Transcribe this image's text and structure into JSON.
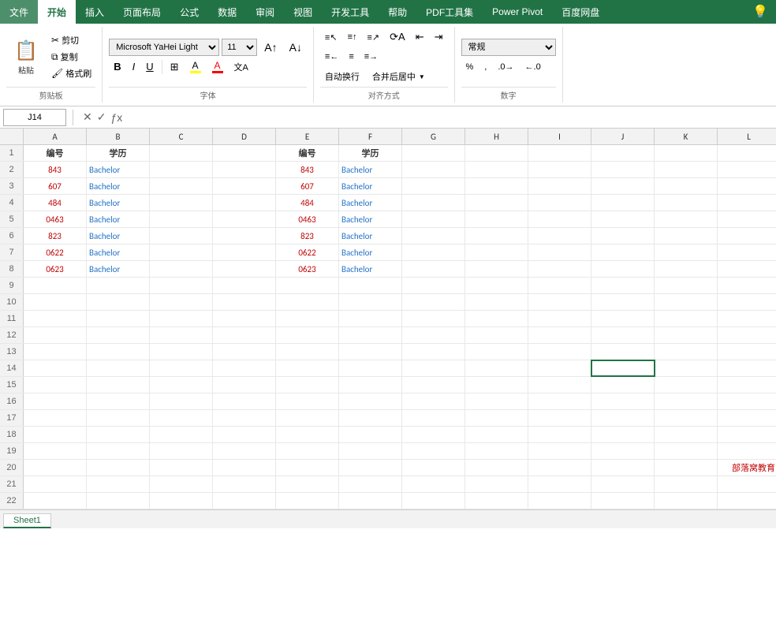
{
  "ribbon": {
    "tabs": [
      "文件",
      "开始",
      "插入",
      "页面布局",
      "公式",
      "数据",
      "审阅",
      "视图",
      "开发工具",
      "帮助",
      "PDF工具集",
      "Power Pivot",
      "百度网盘"
    ],
    "active_tab": "开始",
    "clipboard": {
      "paste": "粘贴",
      "cut": "剪切",
      "copy": "复制",
      "format_paint": "格式刷",
      "label": "剪贴板"
    },
    "font": {
      "name": "Microsoft YaHei Light",
      "size": "11",
      "label": "字体",
      "bold": "B",
      "italic": "I",
      "underline": "U"
    },
    "alignment": {
      "label": "对齐方式",
      "wrap_text": "自动换行",
      "merge_center": "合并后居中"
    },
    "number": {
      "label": "数字",
      "format": "常规"
    }
  },
  "formula_bar": {
    "name_box": "J14",
    "formula": ""
  },
  "columns": [
    "A",
    "B",
    "C",
    "D",
    "E",
    "F",
    "G",
    "H",
    "I",
    "J",
    "K",
    "L"
  ],
  "rows": [
    {
      "num": 1,
      "cells": {
        "A": "编号",
        "B": "学历",
        "E": "编号",
        "F": "学历"
      }
    },
    {
      "num": 2,
      "cells": {
        "A": "843",
        "B": "Bachelor",
        "E": "843",
        "F": "Bachelor"
      }
    },
    {
      "num": 3,
      "cells": {
        "A": "607",
        "B": "Bachelor",
        "E": "607",
        "F": "Bachelor"
      }
    },
    {
      "num": 4,
      "cells": {
        "A": "484",
        "B": "Bachelor",
        "E": "484",
        "F": "Bachelor"
      }
    },
    {
      "num": 5,
      "cells": {
        "A": "0463",
        "B": "Bachelor",
        "E": "0463",
        "F": "Bachelor"
      }
    },
    {
      "num": 6,
      "cells": {
        "A": "823",
        "B": "Bachelor",
        "E": "823",
        "F": "Bachelor"
      }
    },
    {
      "num": 7,
      "cells": {
        "A": "0622",
        "B": "Bachelor",
        "E": "0622",
        "F": "Bachelor"
      }
    },
    {
      "num": 8,
      "cells": {
        "A": "0623",
        "B": "Bachelor",
        "E": "0623",
        "F": "Bachelor"
      }
    },
    {
      "num": 9,
      "cells": {}
    },
    {
      "num": 10,
      "cells": {}
    },
    {
      "num": 11,
      "cells": {}
    },
    {
      "num": 12,
      "cells": {}
    },
    {
      "num": 13,
      "cells": {}
    },
    {
      "num": 14,
      "cells": {}
    },
    {
      "num": 15,
      "cells": {}
    },
    {
      "num": 16,
      "cells": {}
    },
    {
      "num": 17,
      "cells": {}
    },
    {
      "num": 18,
      "cells": {}
    },
    {
      "num": 19,
      "cells": {}
    },
    {
      "num": 20,
      "cells": {
        "L": "部落窝教育"
      }
    },
    {
      "num": 21,
      "cells": {}
    },
    {
      "num": 22,
      "cells": {}
    }
  ],
  "sheet_tabs": [
    "Sheet1"
  ],
  "watermark": "部落窝教育"
}
